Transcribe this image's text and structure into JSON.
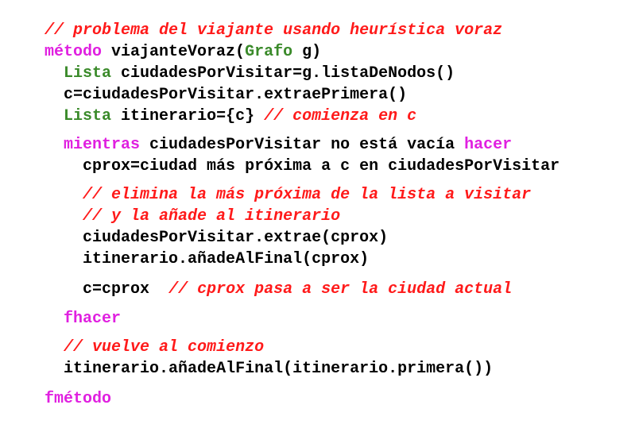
{
  "lines": [
    {
      "indent": "",
      "segments": [
        {
          "kind": "cm",
          "text": "// problema del viajante usando heurística voraz"
        }
      ]
    },
    {
      "indent": "",
      "segments": [
        {
          "kind": "kw",
          "text": "método"
        },
        {
          "kind": "tx",
          "text": " viajanteVoraz("
        },
        {
          "kind": "type",
          "text": "Grafo"
        },
        {
          "kind": "tx",
          "text": " g)"
        }
      ]
    },
    {
      "indent": "  ",
      "segments": [
        {
          "kind": "type",
          "text": "Lista"
        },
        {
          "kind": "tx",
          "text": " ciudadesPorVisitar=g.listaDeNodos()"
        }
      ]
    },
    {
      "indent": "  ",
      "segments": [
        {
          "kind": "tx",
          "text": "c=ciudadesPorVisitar.extraePrimera()"
        }
      ]
    },
    {
      "indent": "  ",
      "segments": [
        {
          "kind": "type",
          "text": "Lista"
        },
        {
          "kind": "tx",
          "text": " itinerario={c} "
        },
        {
          "kind": "cm",
          "text": "// comienza en c"
        }
      ]
    },
    {
      "indent": "  ",
      "segments": [
        {
          "kind": "kw",
          "text": "mientras"
        },
        {
          "kind": "tx",
          "text": " ciudadesPorVisitar no está vacía "
        },
        {
          "kind": "kw",
          "text": "hacer"
        }
      ]
    },
    {
      "indent": "    ",
      "segments": [
        {
          "kind": "tx",
          "text": "cprox=ciudad más próxima a c en ciudadesPorVisitar"
        }
      ]
    },
    {
      "indent": "    ",
      "segments": [
        {
          "kind": "cm",
          "text": "// elimina la más próxima de la lista a visitar"
        }
      ]
    },
    {
      "indent": "    ",
      "segments": [
        {
          "kind": "cm",
          "text": "// y la añade al itinerario"
        }
      ]
    },
    {
      "indent": "    ",
      "segments": [
        {
          "kind": "tx",
          "text": "ciudadesPorVisitar.extrae(cprox)"
        }
      ]
    },
    {
      "indent": "    ",
      "segments": [
        {
          "kind": "tx",
          "text": "itinerario.añadeAlFinal(cprox)"
        }
      ]
    },
    {
      "indent": "    ",
      "segments": [
        {
          "kind": "tx",
          "text": "c=cprox  "
        },
        {
          "kind": "cm",
          "text": "// cprox pasa a ser la ciudad actual"
        }
      ]
    },
    {
      "indent": "  ",
      "segments": [
        {
          "kind": "kw",
          "text": "fhacer"
        }
      ]
    },
    {
      "indent": "  ",
      "segments": [
        {
          "kind": "cm",
          "text": "// vuelve al comienzo"
        }
      ]
    },
    {
      "indent": "  ",
      "segments": [
        {
          "kind": "tx",
          "text": "itinerario.añadeAlFinal(itinerario.primera())"
        }
      ]
    },
    {
      "indent": "",
      "segments": [
        {
          "kind": "kw",
          "text": "fmétodo"
        }
      ]
    }
  ]
}
